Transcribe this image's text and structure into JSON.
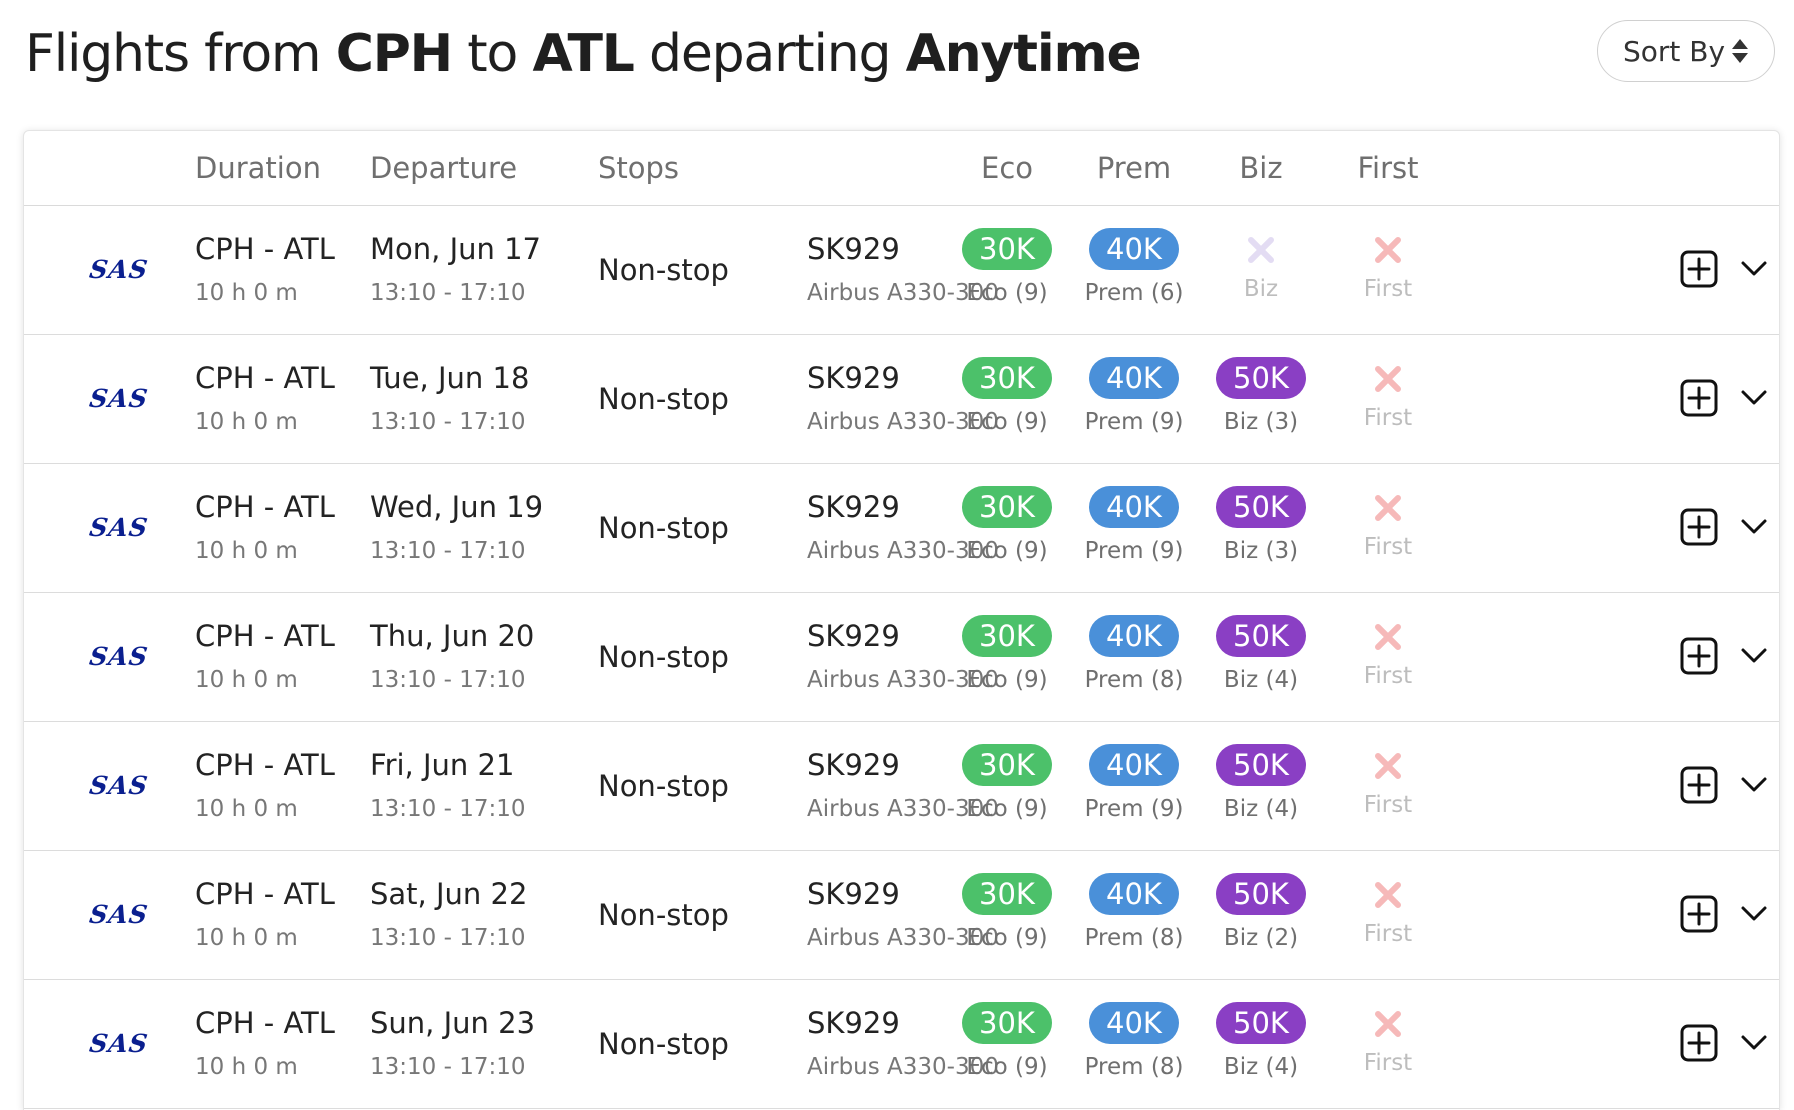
{
  "header": {
    "prefix": "Flights from",
    "origin": "CPH",
    "to_word": "to",
    "destination": "ATL",
    "departing_word": "departing",
    "when": "Anytime"
  },
  "sort": {
    "label": "Sort By",
    "icon": "sort-up-down-icon"
  },
  "columns": {
    "duration": "Duration",
    "departure": "Departure",
    "stops": "Stops",
    "eco": "Eco",
    "prem": "Prem",
    "biz": "Biz",
    "first": "First"
  },
  "colors": {
    "eco": "#4cc16a",
    "prem": "#4a90d9",
    "biz": "#8a3fc4",
    "unavailable_icon": "#f6b9b9",
    "unavailable_icon_light": "#e3dcf3",
    "airline": "#0a1f8f"
  },
  "flights": [
    {
      "airline": "SAS",
      "route": "CPH - ATL",
      "duration": "10 h 0 m",
      "date": "Mon, Jun 17",
      "time": "13:10 - 17:10",
      "stops": "Non-stop",
      "flight_no": "SK929",
      "aircraft": "Airbus A330-300",
      "eco": {
        "price": "30K",
        "label": "Eco (9)"
      },
      "prem": {
        "price": "40K",
        "label": "Prem (6)"
      },
      "biz": {
        "price": "",
        "label": "Biz"
      },
      "first": {
        "price": "",
        "label": "First"
      }
    },
    {
      "airline": "SAS",
      "route": "CPH - ATL",
      "duration": "10 h 0 m",
      "date": "Tue, Jun 18",
      "time": "13:10 - 17:10",
      "stops": "Non-stop",
      "flight_no": "SK929",
      "aircraft": "Airbus A330-300",
      "eco": {
        "price": "30K",
        "label": "Eco (9)"
      },
      "prem": {
        "price": "40K",
        "label": "Prem (9)"
      },
      "biz": {
        "price": "50K",
        "label": "Biz (3)"
      },
      "first": {
        "price": "",
        "label": "First"
      }
    },
    {
      "airline": "SAS",
      "route": "CPH - ATL",
      "duration": "10 h 0 m",
      "date": "Wed, Jun 19",
      "time": "13:10 - 17:10",
      "stops": "Non-stop",
      "flight_no": "SK929",
      "aircraft": "Airbus A330-300",
      "eco": {
        "price": "30K",
        "label": "Eco (9)"
      },
      "prem": {
        "price": "40K",
        "label": "Prem (9)"
      },
      "biz": {
        "price": "50K",
        "label": "Biz (3)"
      },
      "first": {
        "price": "",
        "label": "First"
      }
    },
    {
      "airline": "SAS",
      "route": "CPH - ATL",
      "duration": "10 h 0 m",
      "date": "Thu, Jun 20",
      "time": "13:10 - 17:10",
      "stops": "Non-stop",
      "flight_no": "SK929",
      "aircraft": "Airbus A330-300",
      "eco": {
        "price": "30K",
        "label": "Eco (9)"
      },
      "prem": {
        "price": "40K",
        "label": "Prem (8)"
      },
      "biz": {
        "price": "50K",
        "label": "Biz (4)"
      },
      "first": {
        "price": "",
        "label": "First"
      }
    },
    {
      "airline": "SAS",
      "route": "CPH - ATL",
      "duration": "10 h 0 m",
      "date": "Fri, Jun 21",
      "time": "13:10 - 17:10",
      "stops": "Non-stop",
      "flight_no": "SK929",
      "aircraft": "Airbus A330-300",
      "eco": {
        "price": "30K",
        "label": "Eco (9)"
      },
      "prem": {
        "price": "40K",
        "label": "Prem (9)"
      },
      "biz": {
        "price": "50K",
        "label": "Biz (4)"
      },
      "first": {
        "price": "",
        "label": "First"
      }
    },
    {
      "airline": "SAS",
      "route": "CPH - ATL",
      "duration": "10 h 0 m",
      "date": "Sat, Jun 22",
      "time": "13:10 - 17:10",
      "stops": "Non-stop",
      "flight_no": "SK929",
      "aircraft": "Airbus A330-300",
      "eco": {
        "price": "30K",
        "label": "Eco (9)"
      },
      "prem": {
        "price": "40K",
        "label": "Prem (8)"
      },
      "biz": {
        "price": "50K",
        "label": "Biz (2)"
      },
      "first": {
        "price": "",
        "label": "First"
      }
    },
    {
      "airline": "SAS",
      "route": "CPH - ATL",
      "duration": "10 h 0 m",
      "date": "Sun, Jun 23",
      "time": "13:10 - 17:10",
      "stops": "Non-stop",
      "flight_no": "SK929",
      "aircraft": "Airbus A330-300",
      "eco": {
        "price": "30K",
        "label": "Eco (9)"
      },
      "prem": {
        "price": "40K",
        "label": "Prem (8)"
      },
      "biz": {
        "price": "50K",
        "label": "Biz (4)"
      },
      "first": {
        "price": "",
        "label": "First"
      }
    }
  ]
}
